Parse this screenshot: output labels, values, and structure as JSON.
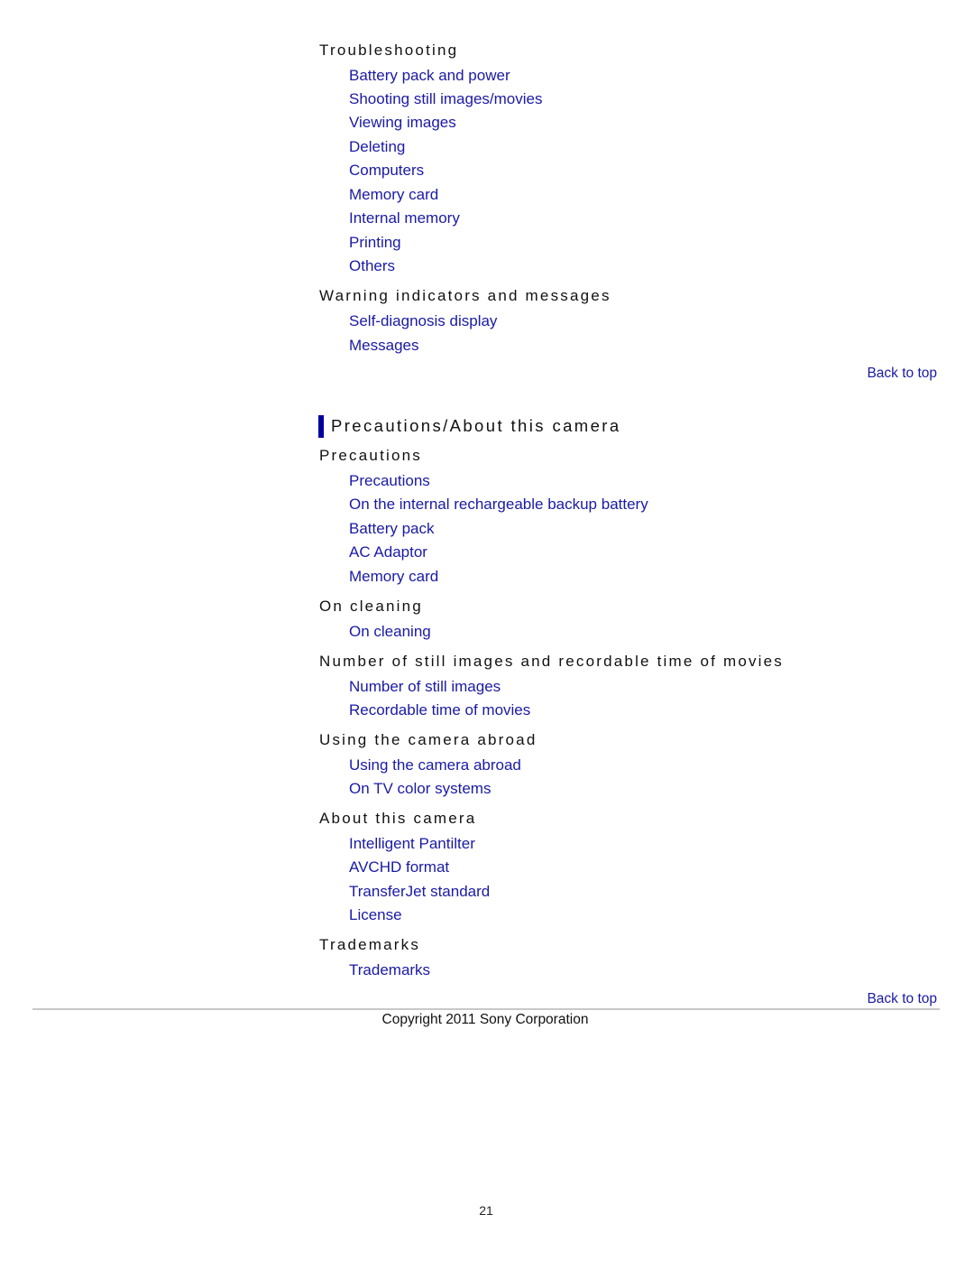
{
  "troubleshooting": {
    "heading": "Troubleshooting",
    "links": [
      "Battery pack and power",
      "Shooting still images/movies",
      "Viewing images",
      "Deleting",
      "Computers",
      "Memory card",
      "Internal memory",
      "Printing",
      "Others"
    ]
  },
  "warning": {
    "heading": "Warning indicators and messages",
    "links": [
      "Self-diagnosis display",
      "Messages"
    ]
  },
  "back_to_top": "Back to top",
  "section": {
    "title": "Precautions/About this camera",
    "accent_color": "#00009e"
  },
  "groups": [
    {
      "heading": "Precautions",
      "links": [
        "Precautions",
        "On the internal rechargeable backup battery",
        "Battery pack",
        "AC Adaptor",
        "Memory card"
      ]
    },
    {
      "heading": "On cleaning",
      "links": [
        "On cleaning"
      ]
    },
    {
      "heading": "Number of still images and recordable time of movies",
      "links": [
        "Number of still images",
        "Recordable time of movies"
      ]
    },
    {
      "heading": "Using the camera abroad",
      "links": [
        "Using the camera abroad",
        "On TV color systems"
      ]
    },
    {
      "heading": "About this camera",
      "links": [
        "Intelligent Pantilter",
        "AVCHD format",
        "TransferJet standard",
        "License"
      ]
    },
    {
      "heading": "Trademarks",
      "links": [
        "Trademarks"
      ]
    }
  ],
  "footer": {
    "copyright": "Copyright 2011 Sony Corporation",
    "page_number": "21"
  },
  "colors": {
    "link": "#1a1aa6",
    "text": "#111111"
  }
}
